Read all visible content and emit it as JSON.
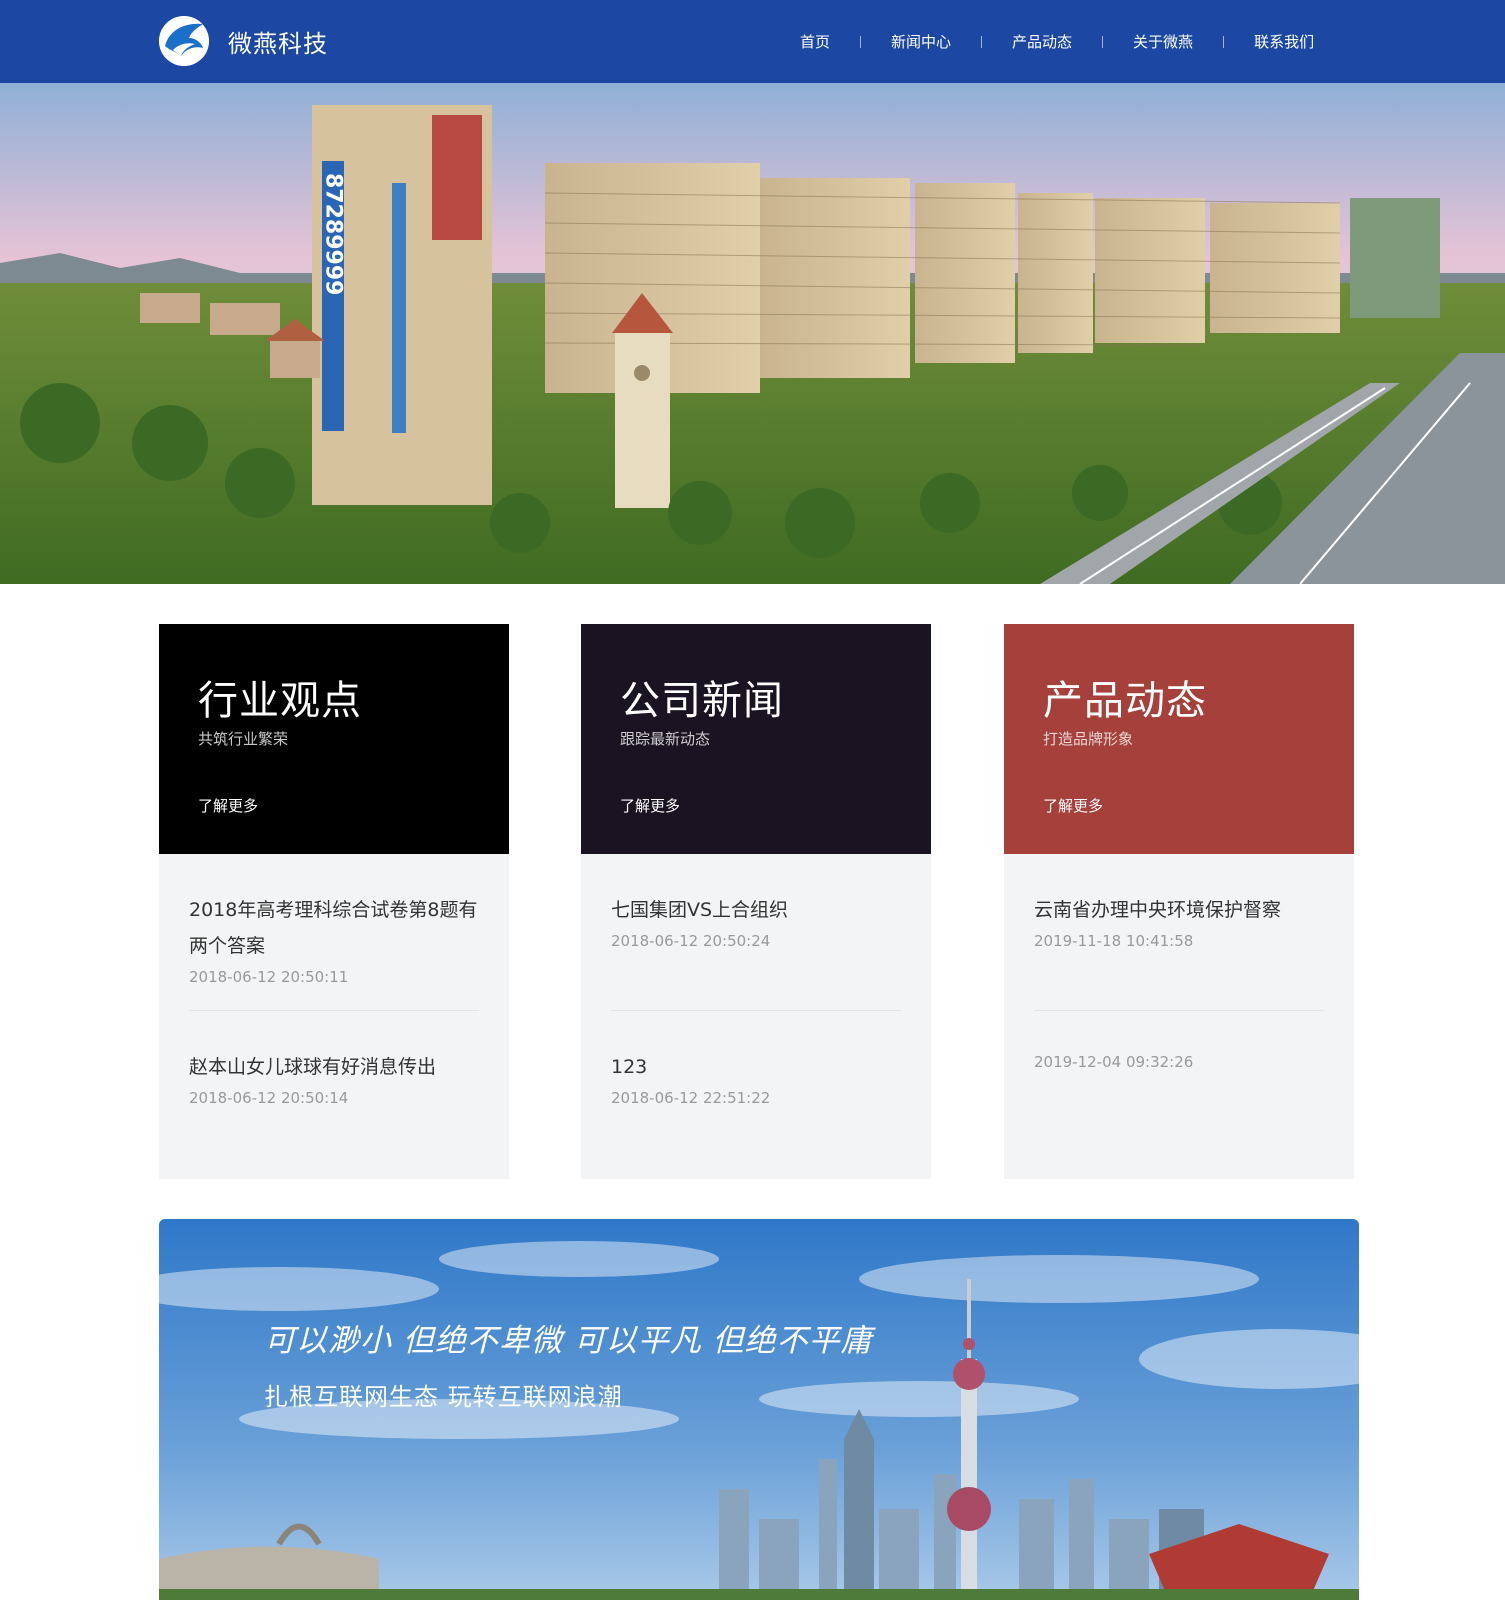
{
  "header": {
    "brand": "微燕科技",
    "nav": [
      {
        "label": "首页"
      },
      {
        "label": "新闻中心"
      },
      {
        "label": "产品动态"
      },
      {
        "label": "关于微燕"
      },
      {
        "label": "联系我们"
      }
    ]
  },
  "hero": {
    "billboard_number": "87289999"
  },
  "cards": [
    {
      "title": "行业观点",
      "subtitle": "共筑行业繁荣",
      "more": "了解更多",
      "color": "#000000",
      "items": [
        {
          "title": "2018年高考理科综合试卷第8题有两个答案",
          "date": "2018-06-12 20:50:11"
        },
        {
          "title": "赵本山女儿球球有好消息传出",
          "date": "2018-06-12 20:50:14"
        }
      ]
    },
    {
      "title": "公司新闻",
      "subtitle": "跟踪最新动态",
      "more": "了解更多",
      "color": "#1a1321",
      "items": [
        {
          "title": "七国集团VS上合组织",
          "date": "2018-06-12 20:50:24"
        },
        {
          "title": "123",
          "date": "2018-06-12 22:51:22"
        }
      ]
    },
    {
      "title": "产品动态",
      "subtitle": "打造品牌形象",
      "more": "了解更多",
      "color": "#a5403a",
      "items": [
        {
          "title": "云南省办理中央环境保护督察",
          "date": "2019-11-18 10:41:58"
        },
        {
          "title": "",
          "date": "2019-12-04 09:32:26"
        }
      ]
    }
  ],
  "banner": {
    "line1": "可以渺小 但绝不卑微 可以平凡 但绝不平庸",
    "line2": "扎根互联网生态 玩转互联网浪潮"
  },
  "colors": {
    "header_bg": "#1c48a4",
    "card_body_bg": "#f3f4f6"
  }
}
